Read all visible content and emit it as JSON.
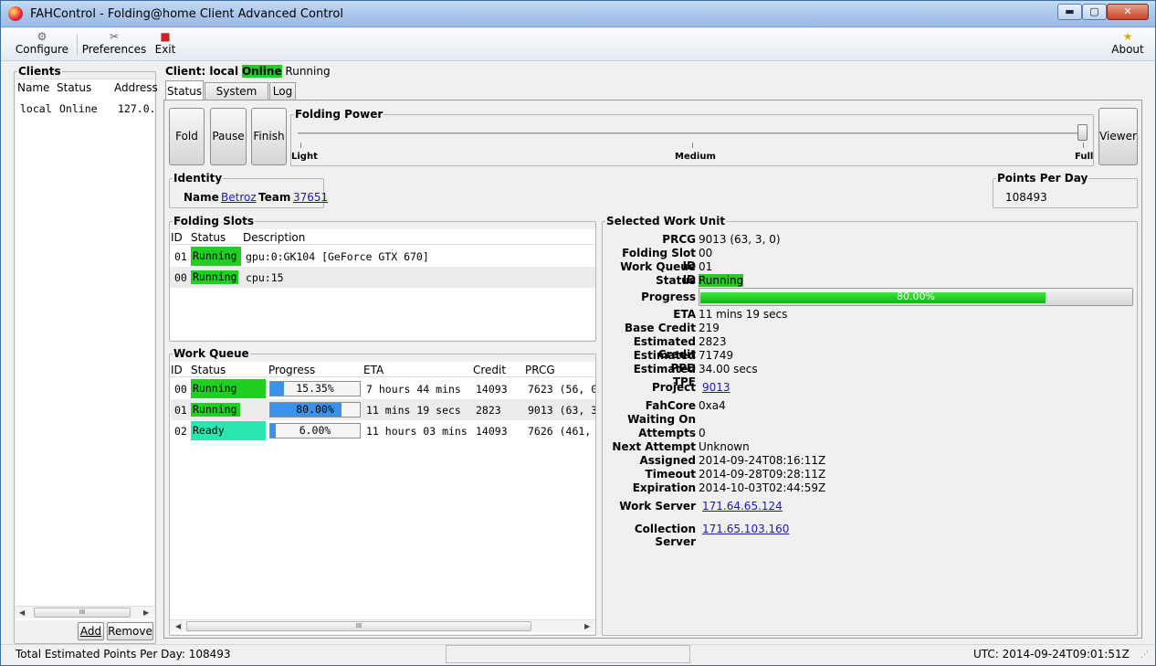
{
  "window": {
    "title": "FAHControl - Folding@home Client Advanced Control",
    "min": "▬",
    "max": "▢",
    "close": "✕"
  },
  "toolbar": {
    "configure": "Configure",
    "preferences": "Preferences",
    "exit": "Exit",
    "about": "About"
  },
  "icons": {
    "configure": "wrench-gear-icon",
    "preferences": "tools-icon",
    "exit": "exit-icon",
    "about": "star-icon"
  },
  "clients": {
    "legend": "Clients",
    "columns": [
      "Name",
      "Status",
      "Address"
    ],
    "rows": [
      {
        "name": "local",
        "status": "Online",
        "address": "127.0."
      }
    ],
    "add": "Add",
    "remove": "Remove",
    "scroll_thumb": "III"
  },
  "client_header": {
    "prefix": "Client: local",
    "online": "Online",
    "state": "Running"
  },
  "tabs": [
    "Status",
    "System Info",
    "Log"
  ],
  "controls": {
    "fold": "Fold",
    "pause": "Pause",
    "finish": "Finish",
    "viewer": "Viewer"
  },
  "folding_power": {
    "legend": "Folding Power",
    "light": "Light",
    "medium": "Medium",
    "full": "Full",
    "level": 1.0
  },
  "identity": {
    "legend": "Identity",
    "name_label": "Name",
    "name": "Betroz",
    "team_label": "Team",
    "team": "37651"
  },
  "ppd": {
    "legend": "Points Per Day",
    "value": "108493"
  },
  "slots": {
    "legend": "Folding Slots",
    "columns": [
      "ID",
      "Status",
      "Description"
    ],
    "rows": [
      {
        "id": "01",
        "status": "Running",
        "desc": "gpu:0:GK104 [GeForce GTX 670]"
      },
      {
        "id": "00",
        "status": "Running",
        "desc": "cpu:15"
      }
    ]
  },
  "queue": {
    "legend": "Work Queue",
    "columns": [
      "ID",
      "Status",
      "Progress",
      "ETA",
      "Credit",
      "PRCG"
    ],
    "rows": [
      {
        "id": "00",
        "status": "Running",
        "progress": "15.35%",
        "pct": 15.35,
        "eta": "7 hours 44 mins",
        "credit": "14093",
        "prcg": "7623 (56, 0"
      },
      {
        "id": "01",
        "status": "Running",
        "progress": "80.00%",
        "pct": 80.0,
        "eta": "11 mins 19 secs",
        "credit": "2823",
        "prcg": "9013 (63, 3"
      },
      {
        "id": "02",
        "status": "Ready",
        "progress": "6.00%",
        "pct": 6.0,
        "eta": "11 hours 03 mins",
        "credit": "14093",
        "prcg": "7626 (461,"
      }
    ],
    "scroll_thumb": "III"
  },
  "wu": {
    "legend": "Selected Work Unit",
    "prcg_l": "PRCG",
    "prcg": "9013 (63, 3, 0)",
    "slot_l": "Folding Slot ID",
    "slot": "00",
    "queue_l": "Work Queue ID",
    "queue": "01",
    "status_l": "Status",
    "status": "Running",
    "progress_l": "Progress",
    "progress": "80.00%",
    "pct": 80.0,
    "eta_l": "ETA",
    "eta": "11 mins 19 secs",
    "base_l": "Base Credit",
    "base": "219",
    "est_credit_l": "Estimated Credit",
    "est_credit": "2823",
    "est_ppd_l": "Estimated PPD",
    "est_ppd": "71749",
    "est_tpf_l": "Estimated TPF",
    "est_tpf": "34.00 secs",
    "project_l": "Project",
    "project": "9013",
    "fahcore_l": "FahCore",
    "fahcore": "0xa4",
    "waiting_l": "Waiting On",
    "waiting": "",
    "attempts_l": "Attempts",
    "attempts": "0",
    "next_l": "Next Attempt",
    "next": "Unknown",
    "assigned_l": "Assigned",
    "assigned": "2014-09-24T08:16:11Z",
    "timeout_l": "Timeout",
    "timeout": "2014-09-28T09:28:11Z",
    "expiration_l": "Expiration",
    "expiration": "2014-10-03T02:44:59Z",
    "ws_l": "Work Server",
    "ws": "171.64.65.124",
    "cs_l": "Collection Server",
    "cs": "171.65.103.160"
  },
  "statusbar": {
    "total": "Total Estimated Points Per Day: 108493",
    "utc": "UTC: 2014-09-24T09:01:51Z"
  },
  "colors": {
    "running": "#20d020",
    "ready": "#2ae6b0",
    "progress": "#3a92ea"
  }
}
